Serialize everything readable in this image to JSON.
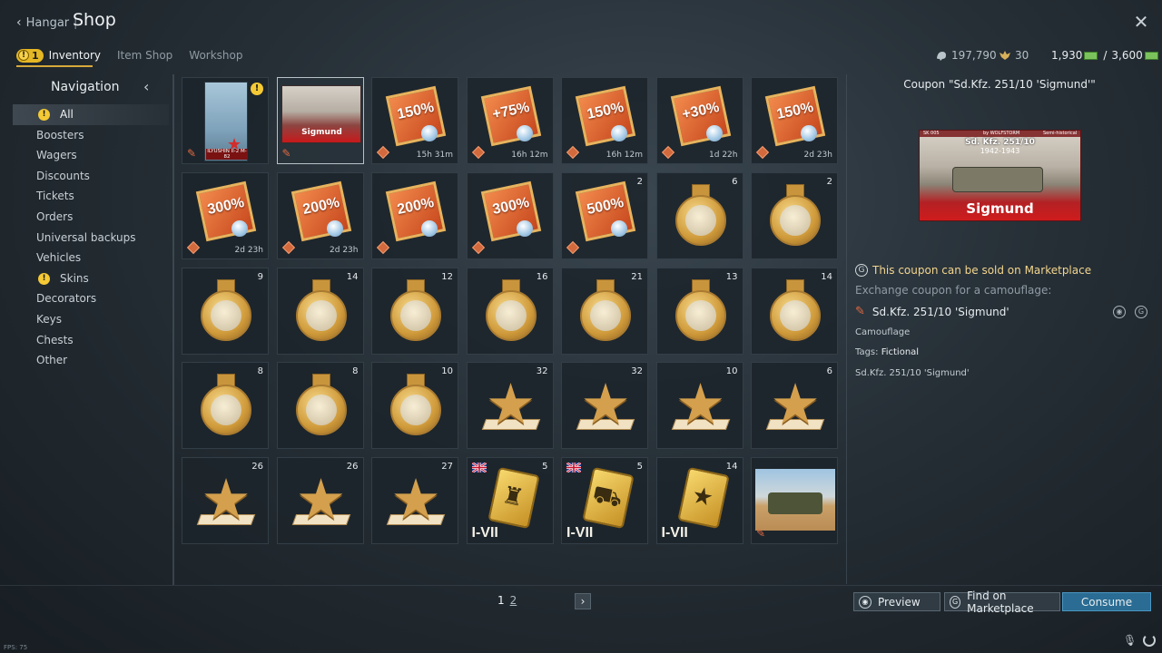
{
  "header": {
    "back_label": "Hangar",
    "separator": "|",
    "title": "Shop",
    "close_icon": "close-icon"
  },
  "tabs": [
    {
      "label": "Inventory",
      "badge": "1",
      "active": true
    },
    {
      "label": "Item Shop",
      "active": false
    },
    {
      "label": "Workshop",
      "active": false
    }
  ],
  "currency": {
    "silver": "197,790",
    "eagles": "30",
    "gold_current": "1,930",
    "gold_sep": "/",
    "gold_max": "3,600"
  },
  "navigation": {
    "title": "Navigation",
    "items": [
      {
        "label": "All",
        "active": true,
        "warn": true
      },
      {
        "label": "Boosters"
      },
      {
        "label": "Wagers"
      },
      {
        "label": "Discounts"
      },
      {
        "label": "Tickets"
      },
      {
        "label": "Orders"
      },
      {
        "label": "Universal backups"
      },
      {
        "label": "Vehicles"
      },
      {
        "label": "Skins",
        "warn": true
      },
      {
        "label": "Decorators"
      },
      {
        "label": "Keys"
      },
      {
        "label": "Chests"
      },
      {
        "label": "Other"
      }
    ]
  },
  "grid": [
    {
      "kind": "plane",
      "label": "ILYUSHIN Il-2 M-82",
      "warn": true
    },
    {
      "kind": "camo",
      "label": "Sigmund",
      "selected": true
    },
    {
      "kind": "booster",
      "pct": "150%",
      "timer": "15h 31m"
    },
    {
      "kind": "booster",
      "pct": "+75%",
      "timer": "16h 12m"
    },
    {
      "kind": "booster",
      "pct": "150%",
      "timer": "16h 12m"
    },
    {
      "kind": "booster",
      "pct": "+30%",
      "timer": "1d 22h"
    },
    {
      "kind": "booster",
      "pct": "150%",
      "timer": "2d 23h"
    },
    {
      "kind": "booster",
      "pct": "300%",
      "timer": "2d 23h"
    },
    {
      "kind": "booster",
      "pct": "200%",
      "timer": "2d 23h"
    },
    {
      "kind": "booster",
      "pct": "200%",
      "timer": ""
    },
    {
      "kind": "booster",
      "pct": "300%",
      "timer": ""
    },
    {
      "kind": "booster",
      "pct": "500%",
      "timer": "",
      "count": "2"
    },
    {
      "kind": "medal",
      "count": "6"
    },
    {
      "kind": "medal",
      "count": "2"
    },
    {
      "kind": "medal",
      "count": "9"
    },
    {
      "kind": "medal",
      "count": "14"
    },
    {
      "kind": "medal",
      "count": "12"
    },
    {
      "kind": "medal",
      "count": "16"
    },
    {
      "kind": "medal",
      "count": "21"
    },
    {
      "kind": "medal",
      "count": "13"
    },
    {
      "kind": "medal",
      "count": "14"
    },
    {
      "kind": "medal",
      "count": "8"
    },
    {
      "kind": "medal",
      "count": "8"
    },
    {
      "kind": "medal",
      "count": "10"
    },
    {
      "kind": "star",
      "count": "32"
    },
    {
      "kind": "star",
      "count": "32"
    },
    {
      "kind": "star",
      "count": "10"
    },
    {
      "kind": "star",
      "count": "6"
    },
    {
      "kind": "star",
      "count": "26"
    },
    {
      "kind": "star",
      "count": "26"
    },
    {
      "kind": "star",
      "count": "27"
    },
    {
      "kind": "card",
      "count": "5",
      "tier": "I-VII",
      "flag": true,
      "icon": "♜"
    },
    {
      "kind": "card",
      "count": "5",
      "tier": "I-VII",
      "flag": true,
      "icon": "⛟"
    },
    {
      "kind": "card",
      "count": "14",
      "tier": "I-VII",
      "flag": false,
      "icon": "★"
    },
    {
      "kind": "tank"
    }
  ],
  "pager": {
    "pages": [
      "1",
      "2"
    ],
    "current": "1"
  },
  "detail": {
    "title": "Coupon \"Sd.Kfz. 251/10 'Sigmund'\"",
    "image": {
      "tag": "SK 005",
      "author": "by WOLFSTORM",
      "kind": "Semi-historical",
      "subtitle": "Sd. Kfz. 251/10",
      "years": "1942-1943",
      "name": "Sigmund"
    },
    "marketplace_note": "This coupon can be sold on Marketplace",
    "exchange_text": "Exchange coupon for a camouflage:",
    "item_name": "Sd.Kfz. 251/10 'Sigmund'",
    "item_type": "Camouflage",
    "tags_label": "Tags:",
    "tags_value": "Fictional",
    "vehicle": "Sd.Kfz. 251/10 'Sigmund'"
  },
  "buttons": {
    "preview": "Preview",
    "find_market": "Find on Marketplace",
    "consume": "Consume"
  },
  "footer": {
    "fps": "FPS: 75"
  },
  "colors": {
    "accent_gold": "#d7a93a",
    "consume_blue": "#2a6c93",
    "booster_orange": "#d2582a",
    "marketplace_text": "#f3d58e"
  }
}
